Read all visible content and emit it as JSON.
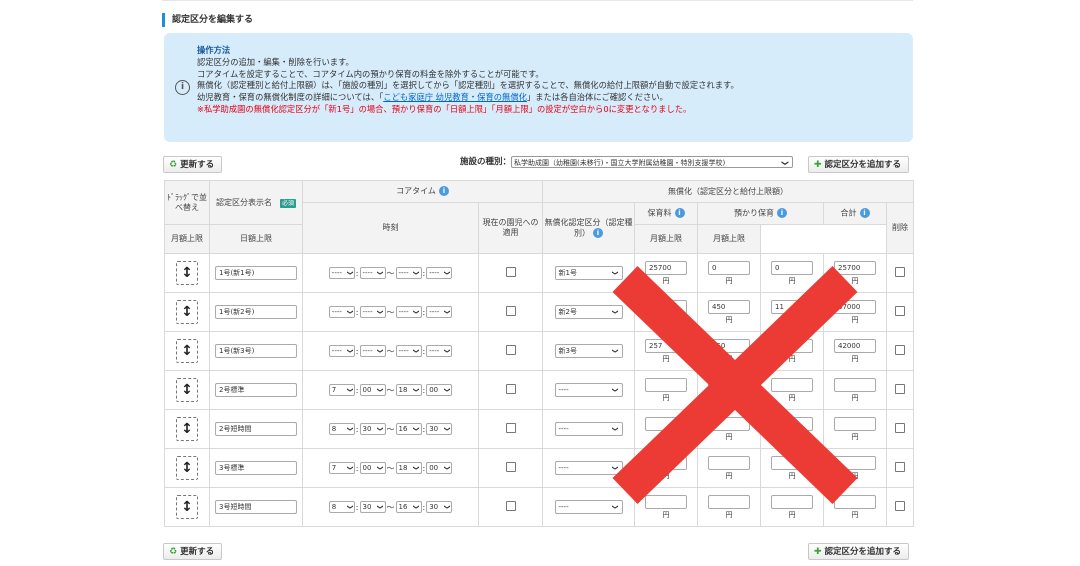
{
  "page": {
    "title": "認定区分を編集する"
  },
  "info": {
    "title": "操作方法",
    "line1": "認定区分の追加・編集・削除を行います。",
    "line2": "コアタイムを設定することで、コアタイム内の預かり保育の料金を除外することが可能です。",
    "line3": "無償化（認定種別と給付上限額）は、「施設の種別」を選択してから「認定種別」を選択することで、無償化の給付上限額が自動で設定されます。",
    "line4_pre": "幼児教育・保育の無償化制度の詳細については、「",
    "line4_link": "こども家庭庁 幼児教育・保育の無償化",
    "line4_post": "」または各自治体にご確認ください。",
    "line5": "※私学助成園の無償化認定区分が「新1号」の場合、預かり保育の「日額上限」「月額上限」の設定が空白から0に変更となりました。"
  },
  "toolbar": {
    "update_label": "更新する",
    "add_label": "認定区分を追加する",
    "facility_label": "施設の種別：",
    "facility_value": "私学助成園（幼稚園(未移行)・国立大学附属幼稚園・特別支援学校)"
  },
  "table": {
    "headers": {
      "drag": "ﾄﾞﾗｯｸﾞで並べ替え",
      "name": "認定区分表示名",
      "required": "必須",
      "coretime": "コアタイム",
      "time": "時刻",
      "current": "現在の園児への適用",
      "free": "無償化（認定区分と給付上限額）",
      "free_cat": "無償化認定区分（認定種別）",
      "hoiku": "保育料",
      "azukari": "預かり保育",
      "total": "合計",
      "delete": "削除",
      "monthly": "月額上限",
      "daily": "日額上限"
    },
    "yen": "円",
    "rows": [
      {
        "name": "1号(新1号)",
        "t1": "----",
        "t2": "----",
        "t3": "----",
        "t4": "----",
        "cat": "新1号",
        "hoiku": "25700",
        "daily": "0",
        "monthly": "0",
        "total": "25700"
      },
      {
        "name": "1号(新2号)",
        "t1": "----",
        "t2": "----",
        "t3": "----",
        "t4": "----",
        "cat": "新2号",
        "hoiku": "",
        "daily": "450",
        "monthly": "11",
        "total": "37000"
      },
      {
        "name": "1号(新3号)",
        "t1": "----",
        "t2": "----",
        "t3": "----",
        "t4": "----",
        "cat": "新3号",
        "hoiku": "257",
        "daily": "450",
        "monthly": "",
        "total": "42000"
      },
      {
        "name": "2号標準",
        "t1": "7",
        "t2": "00",
        "t3": "18",
        "t4": "00",
        "cat": "----",
        "hoiku": "",
        "daily": "",
        "monthly": "",
        "total": ""
      },
      {
        "name": "2号短時間",
        "t1": "8",
        "t2": "30",
        "t3": "16",
        "t4": "30",
        "cat": "----",
        "hoiku": "",
        "daily": "",
        "monthly": "",
        "total": ""
      },
      {
        "name": "3号標準",
        "t1": "7",
        "t2": "00",
        "t3": "18",
        "t4": "00",
        "cat": "----",
        "hoiku": "",
        "daily": "",
        "monthly": "",
        "total": ""
      },
      {
        "name": "3号短時間",
        "t1": "8",
        "t2": "30",
        "t3": "16",
        "t4": "30",
        "cat": "----",
        "hoiku": "",
        "daily": "",
        "monthly": "",
        "total": ""
      }
    ]
  },
  "colors": {
    "accent": "#1e8fd6",
    "info_bg": "#d6ecfb",
    "red": "#e60012",
    "cross": "#ec3a34"
  }
}
